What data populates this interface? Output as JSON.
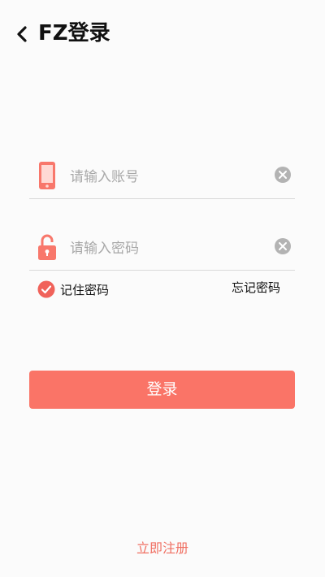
{
  "header": {
    "back_icon": "chevron-left-icon",
    "title": "FZ登录"
  },
  "account": {
    "placeholder": "请输入账号",
    "value": "",
    "icon": "phone-icon",
    "clear_icon": "clear-icon"
  },
  "password": {
    "placeholder": "请输入密码",
    "value": "",
    "icon": "unlock-icon",
    "clear_icon": "clear-icon"
  },
  "remember": {
    "label": "记住密码",
    "checked": true,
    "icon": "check-circle-icon"
  },
  "forgot_label": "忘记密码",
  "login_label": "登录",
  "register_label": "立即注册",
  "colors": {
    "accent": "#fa7467",
    "register_text": "#f06f62",
    "divider": "#d9d9d9",
    "placeholder": "#a8a8a8"
  }
}
